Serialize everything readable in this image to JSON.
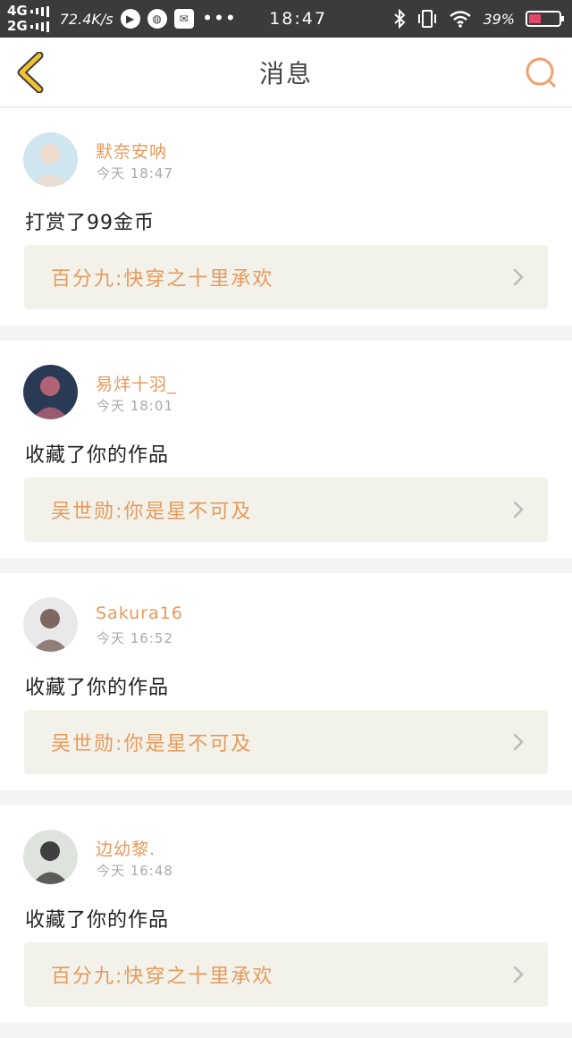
{
  "status": {
    "net1": "4G",
    "net2": "2G",
    "speed": "72.4K/s",
    "time": "18:47",
    "battery": "39%",
    "battery_level": 0.39,
    "accent": "#e5466a"
  },
  "nav": {
    "title": "消息",
    "back_icon": "chevron-left-icon",
    "search_icon": "search-icon",
    "accent": "#f2c230"
  },
  "messages": [
    {
      "user": "默奈安呐",
      "time": "今天 18:47",
      "action": "打赏了99金币",
      "work": "百分九:快穿之十里承欢",
      "avatar_colors": [
        "#cfe6f0",
        "#f3d8c8"
      ]
    },
    {
      "user": "易烊十羽_",
      "time": "今天 18:01",
      "action": "收藏了你的作品",
      "work": "吴世勋:你是星不可及",
      "avatar_colors": [
        "#2a3a55",
        "#c96b7a"
      ]
    },
    {
      "user": "Sakura16",
      "time": "今天 16:52",
      "action": "收藏了你的作品",
      "work": "吴世勋:你是星不可及",
      "avatar_colors": [
        "#e9e9e9",
        "#6b5048"
      ]
    },
    {
      "user": "边幼黎.",
      "time": "今天 16:48",
      "action": "收藏了你的作品",
      "work": "百分九:快穿之十里承欢",
      "avatar_colors": [
        "#dfe3de",
        "#222222"
      ]
    }
  ],
  "colors": {
    "name": "#e79a5b",
    "work_bg": "#f2f2ea",
    "status_bar": "#3b3b3b"
  }
}
